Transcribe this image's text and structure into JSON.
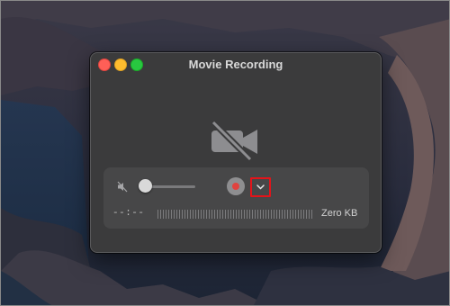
{
  "window": {
    "title": "Movie Recording"
  },
  "controls": {
    "volume_level": 0.1,
    "elapsed_time": "--:--",
    "file_size": "Zero KB"
  },
  "icons": {
    "camera_disabled": "video-camera-off-icon",
    "mute": "speaker-muted-icon",
    "record": "record-icon",
    "options": "chevron-down-icon"
  },
  "colors": {
    "highlight": "#e3141a",
    "record": "#e0433f"
  }
}
